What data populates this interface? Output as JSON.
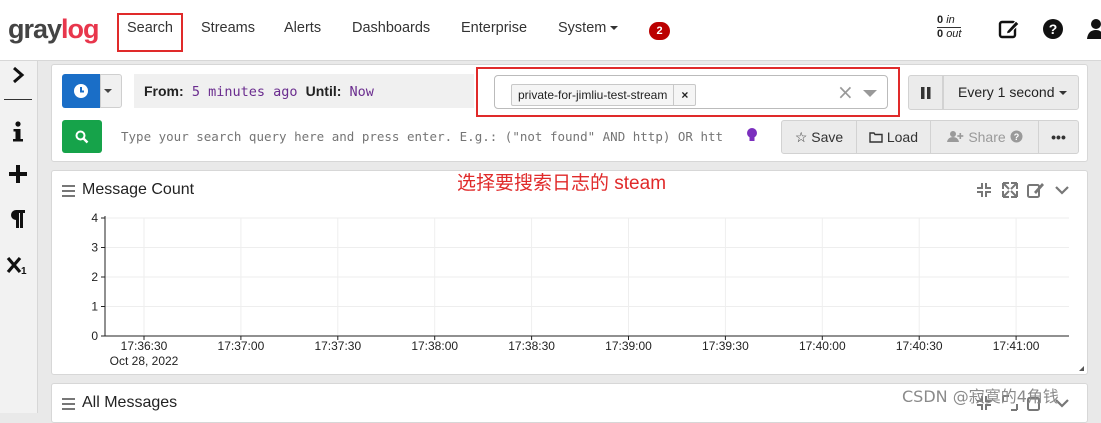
{
  "brand": {
    "gray": "gray",
    "log": "log"
  },
  "nav": {
    "items": [
      "Search",
      "Streams",
      "Alerts",
      "Dashboards",
      "Enterprise",
      "System"
    ],
    "notifications_count": "2",
    "throughput_in": "0",
    "throughput_in_label": "in",
    "throughput_out": "0",
    "throughput_out_label": "out"
  },
  "sidebar": {
    "icons": [
      "chevron-right-icon",
      "info-icon",
      "plus-icon",
      "paragraph-icon",
      "subscript-icon"
    ]
  },
  "search": {
    "from_label": "From:",
    "from_value": "5 minutes ago",
    "until_label": "Until:",
    "until_value": "Now",
    "stream": "private-for-jimliu-test-stream",
    "refresh_label": "Every 1 second",
    "query_placeholder": "Type your search query here and press enter. E.g.: (\"not found\" AND http) OR htt",
    "save_label": "Save",
    "load_label": "Load",
    "share_label": "Share"
  },
  "annotation": "选择要搜索日志的 steam",
  "widgets": {
    "message_count_title": "Message Count",
    "all_messages_title": "All Messages"
  },
  "chart_data": {
    "type": "line",
    "title": "Message Count",
    "x": [
      "17:36:30",
      "17:37:00",
      "17:37:30",
      "17:38:00",
      "17:38:30",
      "17:39:00",
      "17:39:30",
      "17:40:00",
      "17:40:30",
      "17:41:00"
    ],
    "x_sublabel": "Oct 28, 2022",
    "y_ticks": [
      0,
      1,
      2,
      3,
      4
    ],
    "ylim": [
      0,
      4
    ],
    "series": [],
    "grid": true
  },
  "watermark": "CSDN @寂寞的4角钱",
  "colors": {
    "accent_red": "#e02a2a",
    "primary_blue": "#1a6ec7",
    "success_green": "#16a34a"
  }
}
